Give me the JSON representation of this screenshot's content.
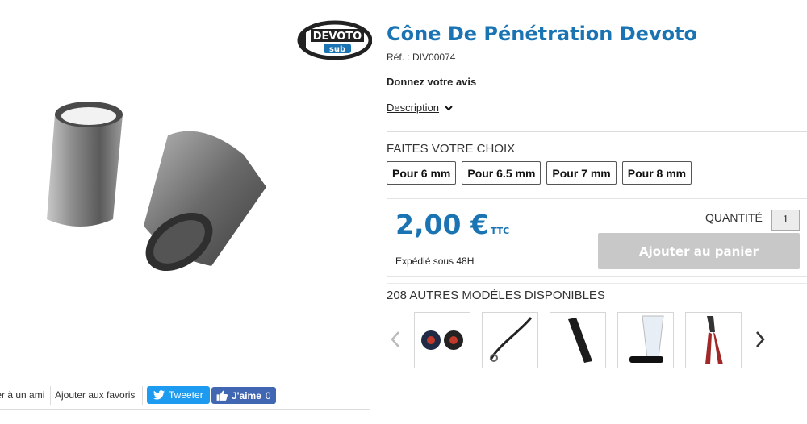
{
  "brand": {
    "logo_text_top": "DEVOTO",
    "logo_text_bottom": "sub"
  },
  "product": {
    "title": "Cône De Pénétration Devoto",
    "ref_label": "Réf. : ",
    "ref_value": "DIV00074",
    "review_label": "Donnez votre avis",
    "description_label": "Description"
  },
  "choice": {
    "title": "FAITES VOTRE CHOIX",
    "options": [
      "Pour 6 mm",
      "Pour 6.5 mm",
      "Pour 7 mm",
      "Pour 8 mm"
    ]
  },
  "purchase": {
    "price": "2,00 €",
    "price_suffix": "TTC",
    "shipping": "Expédié sous 48H",
    "quantity_label": "QUANTITÉ",
    "quantity_value": "1",
    "add_to_cart": "Ajouter au panier"
  },
  "others": {
    "title": "208 AUTRES MODÈLES DISPONIBLES",
    "thumbnails": [
      "reel-icon",
      "lanyard-icon",
      "handle-icon",
      "fin-icon",
      "crimping-pliers-icon"
    ]
  },
  "share": {
    "send_friend": "Envoyer à un ami",
    "add_favorites": "Ajouter aux favoris",
    "tweet": "Tweeter",
    "like": "J'aime",
    "like_count": "0"
  },
  "colors": {
    "accent": "#1a74b3",
    "cart_disabled": "#c8c8c8",
    "twitter": "#1d9bf0",
    "facebook": "#4267b2"
  }
}
